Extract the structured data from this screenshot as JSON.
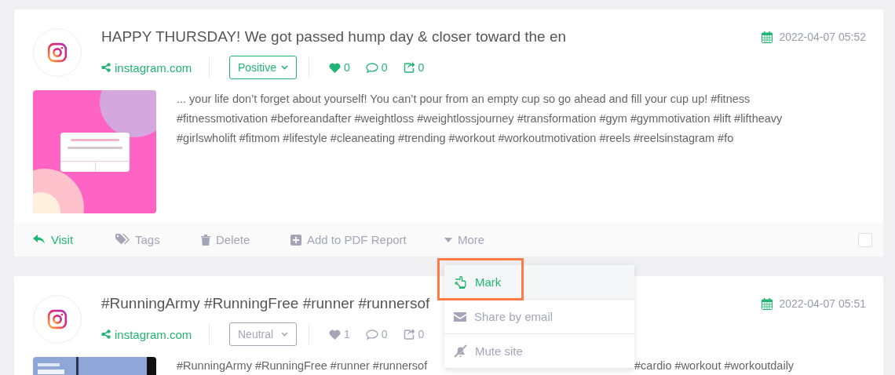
{
  "posts": [
    {
      "title": "HAPPY THURSDAY! We got passed hump day & closer toward the en",
      "date": "2022-04-07 05:52",
      "source": "instagram.com",
      "sentiment": {
        "label": "Positive",
        "kind": "positive"
      },
      "likes": "0",
      "comments": "0",
      "shares": "0",
      "body": [
        {
          "kind": "text",
          "text": "... your life don’t forget about yourself! You can’t pour from an empty cup so go ahead and fill your cup up! #fitness #fitnessmotivation #beforeandafter #weightloss #weightlossjourney #transformation #gym #gymmotivation #lift #liftheavy #girlswholift #fitmom #lifestyle #cleaneating #trending #workout #workoutmotivation #reels #reelsinstagram #fo"
        }
      ],
      "image": {
        "kind": "picture"
      },
      "actions": [
        {
          "kind": "visit",
          "label": "Visit"
        },
        {
          "kind": "tags",
          "label": "Tags"
        },
        {
          "kind": "delete",
          "label": "Delete"
        },
        {
          "kind": "pdf",
          "label": "Add to PDF Report"
        },
        {
          "kind": "more",
          "label": "More",
          "expanded": true
        }
      ],
      "checked": false
    },
    {
      "title": "#RunningArmy #RunningFree #runner #runnersof",
      "date": "2022-04-07 05:51",
      "source": "instagram.com",
      "sentiment": {
        "label": "Neutral",
        "kind": "neutral"
      },
      "likes": "1",
      "comments": "0",
      "shares": "0",
      "body": [
        {
          "kind": "before_menu",
          "text": "#RunningArmy #RunningFree #runner #runnersof"
        },
        {
          "kind": "after_menu",
          "text": "#cardio #workout #workoutdaily"
        }
      ],
      "image": {
        "kind": "picture"
      }
    }
  ],
  "menu": [
    {
      "kind": "mark",
      "label": "Mark",
      "selected": true
    },
    {
      "kind": "email",
      "label": "Share by email",
      "selected": false
    },
    {
      "kind": "mute",
      "label": "Mute site",
      "selected": false
    }
  ]
}
